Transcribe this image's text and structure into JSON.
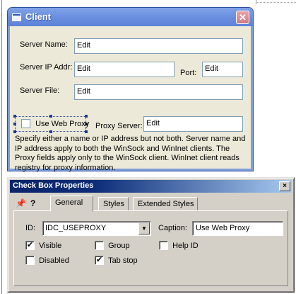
{
  "client_dialog": {
    "title": "Client",
    "close_glyph": "✕",
    "server_name_label": "Server Name:",
    "server_name_value": "Edit",
    "server_ip_label": "Server IP Addr:",
    "server_ip_value": "Edit",
    "port_label": "Port:",
    "port_value": "Edit",
    "server_file_label": "Server File:",
    "server_file_value": "Edit",
    "use_web_proxy_label": "Use Web Proxy",
    "proxy_server_label": "Proxy Server:",
    "proxy_server_value": "Edit",
    "help_text": "Specify either a name or IP address but not both. Server name and IP address apply to both the WinSock and WinInet clients. The Proxy fields apply only to the WinSock client. WinInet client reads registry for proxy information."
  },
  "props_window": {
    "title": "Check Box Properties",
    "close_glyph": "×",
    "pin_icon": "📌",
    "help_icon": "?",
    "tabs": [
      {
        "label": "General",
        "active": true
      },
      {
        "label": "Styles",
        "active": false
      },
      {
        "label": "Extended Styles",
        "active": false
      }
    ],
    "id_label": "ID:",
    "id_value": "IDC_USEPROXY",
    "caption_label": "Caption:",
    "caption_value": "Use Web Proxy",
    "checkboxes": [
      {
        "label": "Visible",
        "checked": true
      },
      {
        "label": "Group",
        "checked": false
      },
      {
        "label": "Help ID",
        "checked": false
      },
      {
        "label": "Disabled",
        "checked": false
      },
      {
        "label": "Tab stop",
        "checked": true
      }
    ]
  }
}
